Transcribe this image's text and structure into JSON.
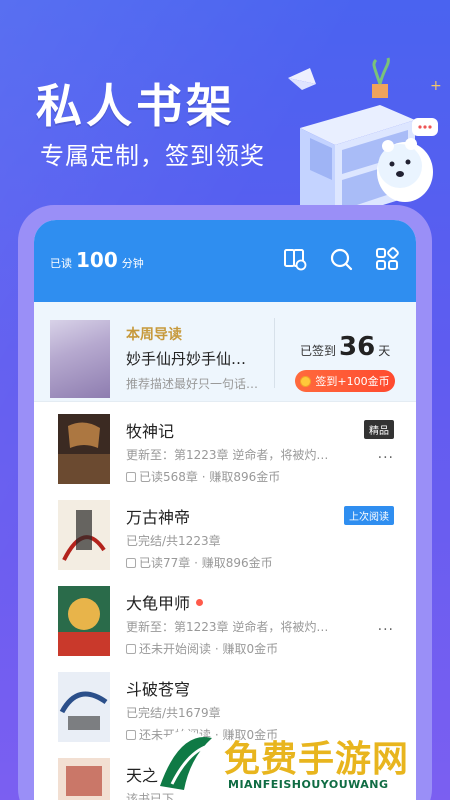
{
  "promo": {
    "title": "私人书架",
    "subtitle": "专属定制，签到领奖"
  },
  "header": {
    "read_prefix": "已读",
    "read_minutes": "100",
    "read_unit": "分钟",
    "icons": [
      "book-sync-icon",
      "search-icon",
      "grid-icon"
    ]
  },
  "guide": {
    "tag": "本周导读",
    "title": "妙手仙丹妙手仙…",
    "desc": "推荐描述最好只一句话…",
    "signed_prefix": "已签到",
    "signed_days": "36",
    "signed_unit": "天",
    "sign_button": "签到+100金币"
  },
  "books": [
    {
      "title": "牧神记",
      "line2": "更新至：第1223章 逆命者，将被灼…",
      "line3": "已读568章 · 赚取896金币",
      "badge": "精品",
      "badge_style": "dark",
      "dot": false
    },
    {
      "title": "万古神帝",
      "line2": "已完结/共1223章",
      "line3": "已读77章 · 赚取896金币",
      "badge": "上次阅读",
      "badge_style": "blue",
      "dot": false
    },
    {
      "title": "大龟甲师",
      "line2": "更新至：第1223章 逆命者，将被灼…",
      "line3": "还未开始阅读 · 赚取0金币",
      "badge": "",
      "badge_style": "",
      "dot": true
    },
    {
      "title": "斗破苍穹",
      "line2": "已完结/共1679章",
      "line3": "还未开始阅读 · 赚取0金币",
      "badge": "",
      "badge_style": "",
      "dot": false
    },
    {
      "title": "天之…",
      "line2": "该书已下…",
      "line3": "",
      "badge": "",
      "badge_style": "",
      "dot": false
    }
  ],
  "more_glyph": "···",
  "watermark": {
    "text": "免费手游网",
    "sub": "MIANFEISHOUYOUWANG"
  },
  "colors": {
    "header_blue": "#2f8ef0",
    "sign_orange": "#ff5a36",
    "watermark_gold": "#e8b51e"
  }
}
